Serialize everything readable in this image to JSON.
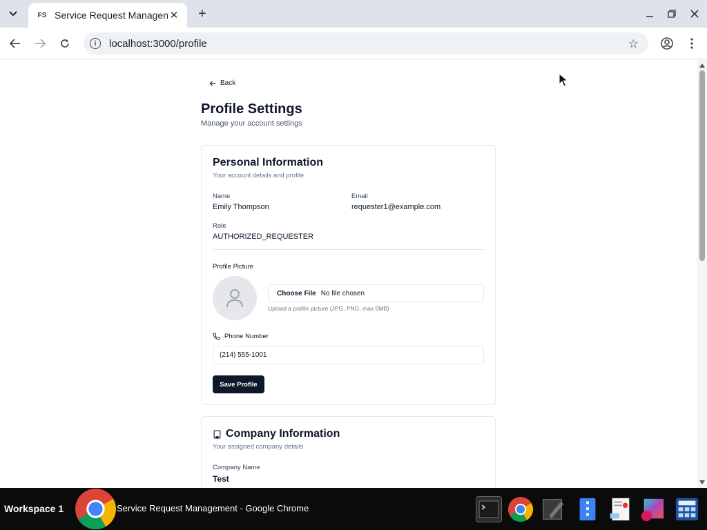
{
  "browser": {
    "tab_title": "Service Request Managen",
    "tab_favicon": "FS",
    "url": "localhost:3000/profile"
  },
  "page": {
    "back_label": "Back",
    "title": "Profile Settings",
    "subtitle": "Manage your account settings"
  },
  "personal": {
    "title": "Personal Information",
    "subtitle": "Your account details and profile",
    "name_label": "Name",
    "name_value": "Emily Thompson",
    "email_label": "Email",
    "email_value": "requester1@example.com",
    "role_label": "Role",
    "role_value": "AUTHORIZED_REQUESTER",
    "picture_label": "Profile Picture",
    "choose_file_label": "Choose File",
    "no_file_label": "No file chosen",
    "upload_hint": "Upload a profile picture (JPG, PNG, max 5MB)",
    "phone_label": "Phone Number",
    "phone_value": "(214) 555-1001",
    "save_label": "Save Profile"
  },
  "company": {
    "title": "Company Information",
    "subtitle": "Your assigned company details",
    "name_label": "Company Name",
    "name_value": "Test"
  },
  "taskbar": {
    "workspace": "Workspace 1",
    "window_title": "Service Request Management - Google Chrome"
  }
}
